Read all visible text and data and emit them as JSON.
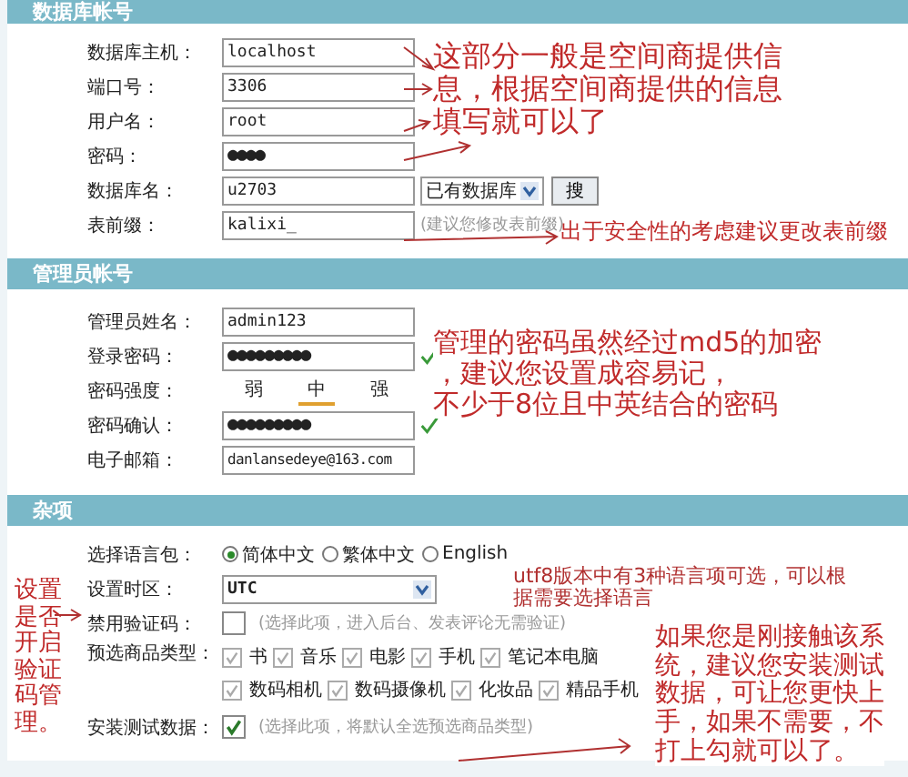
{
  "sections": [
    {
      "title": "数据库帐号",
      "fields": [
        {
          "kind": "text",
          "label": "数据库主机：",
          "value": "localhost"
        },
        {
          "kind": "text",
          "label": "端口号：",
          "value": "3306"
        },
        {
          "kind": "text",
          "label": "用户名：",
          "value": "root"
        },
        {
          "kind": "password",
          "label": "密码：",
          "value": "●●●●",
          "valid": false
        },
        {
          "kind": "db",
          "label": "数据库名：",
          "value": "u2703",
          "select": "已有数据库",
          "button": "搜"
        },
        {
          "kind": "hinted",
          "label": "表前缀：",
          "value": "kalixi_",
          "hint": "(建议您修改表前缀)"
        }
      ]
    },
    {
      "title": "管理员帐号",
      "fields": [
        {
          "kind": "text",
          "label": "管理员姓名：",
          "value": "admin123"
        },
        {
          "kind": "password",
          "label": "登录密码：",
          "value": "●●●●●●●●●",
          "valid": true
        },
        {
          "kind": "strength",
          "label": "密码强度：",
          "options": [
            {
              "label": "弱",
              "selected": false
            },
            {
              "label": "中",
              "selected": true
            },
            {
              "label": "强",
              "selected": false
            }
          ]
        },
        {
          "kind": "password",
          "label": "密码确认：",
          "value": "●●●●●●●●●",
          "valid": true
        },
        {
          "kind": "text",
          "label": "电子邮箱：",
          "value": "danlansedeye@163.com"
        }
      ]
    },
    {
      "title": "杂项",
      "fields": [
        {
          "kind": "radio",
          "label": "选择语言包：",
          "options": [
            {
              "label": "简体中文",
              "selected": true
            },
            {
              "label": "繁体中文",
              "selected": false
            },
            {
              "label": "English",
              "selected": false
            }
          ]
        },
        {
          "kind": "select",
          "label": "设置时区：",
          "value": "UTC"
        },
        {
          "kind": "checkbox",
          "label": "禁用验证码：",
          "checked": false,
          "hint": "(选择此项，进入后台、发表评论无需验证)"
        },
        {
          "kind": "checkgrid",
          "label": "预选商品类型：",
          "options": [
            {
              "label": "书",
              "checked": true
            },
            {
              "label": "音乐",
              "checked": true
            },
            {
              "label": "电影",
              "checked": true
            },
            {
              "label": "手机",
              "checked": true
            },
            {
              "label": "笔记本电脑",
              "checked": true
            },
            {
              "label": "数码相机",
              "checked": true
            },
            {
              "label": "数码摄像机",
              "checked": true
            },
            {
              "label": "化妆品",
              "checked": true
            },
            {
              "label": "精品手机",
              "checked": true
            }
          ]
        },
        {
          "kind": "checkbox",
          "label": "安装测试数据：",
          "checked": true,
          "hint": "(选择此项，将默认全选预选商品类型)"
        }
      ]
    }
  ],
  "annotations": [
    {
      "lines": [
        "这部分一般是空间商提供信",
        "息，根据空间商提供的信息",
        "填写就可以了"
      ]
    },
    {
      "lines": [
        "出于安全性的考虑建议更改表前缀"
      ]
    },
    {
      "lines": [
        "管理的密码虽然经过md5的加密",
        "，建议您设置成容易记，",
        "不少于8位且中英结合的密码"
      ]
    },
    {
      "lines": [
        "utf8版本中有3种语言项可选，可以根",
        "据需要选择语言"
      ]
    },
    {
      "lines": [
        "如果您是刚接触该系",
        "统，建议您安装测试",
        "数据，可让您更快上",
        "手，如果不需要，不",
        "打上勾就可以了。"
      ]
    },
    {
      "lines": [
        "设置",
        "是否",
        "开启",
        "验证",
        "码管",
        "理。"
      ]
    }
  ]
}
